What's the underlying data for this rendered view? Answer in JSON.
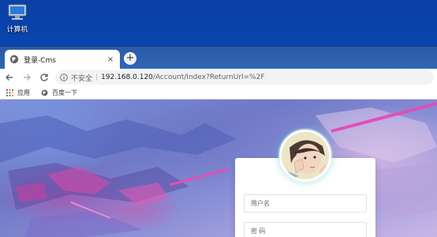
{
  "desktop": {
    "icon_label": "计算机"
  },
  "browser": {
    "tab": {
      "title": "登录-Cms",
      "close_glyph": "×"
    },
    "new_tab_glyph": "+",
    "omnibox": {
      "security_label": "不安全",
      "separator": "|",
      "host": "192.168.0.120",
      "path": "/Account/Index?ReturnUrl=%2F"
    },
    "bookmarks": [
      {
        "label": "应用",
        "icon": "apps-grid-icon"
      },
      {
        "label": "百度一下",
        "icon": "globe-icon"
      }
    ]
  },
  "login": {
    "username_placeholder": "用户名",
    "password_placeholder": "密 码"
  },
  "colors": {
    "desktop_blue": "#0b4bb8",
    "tab_strip": "#2f66b6",
    "accent_pink": "#e04fb8",
    "avatar_glow": "#46c8c8"
  }
}
